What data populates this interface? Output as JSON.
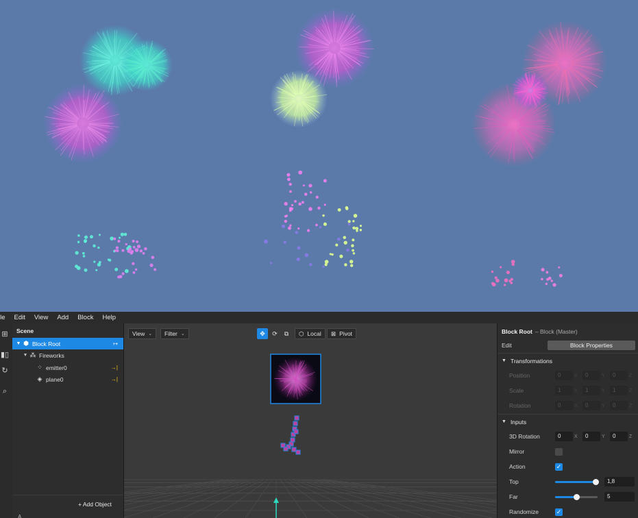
{
  "menu": [
    "ile",
    "Edit",
    "View",
    "Add",
    "Block",
    "Help"
  ],
  "scene": {
    "header": "Scene",
    "items": [
      {
        "label": "Block Root",
        "icon": "cube-icon",
        "trail": "↦"
      },
      {
        "label": "Fireworks",
        "icon": "fireworks-group-icon"
      },
      {
        "label": "emitter0",
        "icon": "emitter-icon",
        "trail": "→|"
      },
      {
        "label": "plane0",
        "icon": "plane-icon",
        "trail": "→|"
      }
    ],
    "add_object": "+ Add Object",
    "footer": "A"
  },
  "viewport": {
    "view_label": "View",
    "filter_label": "Filter",
    "local_label": "Local",
    "pivot_label": "Pivot"
  },
  "props": {
    "title": "Block Root",
    "subtitle": "– Block (Master)",
    "edit_label": "Edit",
    "block_properties": "Block Properties",
    "transformations": "Transformations",
    "position": "Position",
    "scale": "Scale",
    "rotation": "Rotation",
    "pos_values": [
      "0",
      "0",
      "0"
    ],
    "scale_values": [
      "1",
      "1",
      "1"
    ],
    "rot_values": [
      "0",
      "0",
      "0"
    ],
    "axes": [
      "X",
      "Y",
      "Z"
    ],
    "inputs": "Inputs",
    "rotation3d": "3D Rotation",
    "rotation3d_values": [
      "0",
      "0",
      "0"
    ],
    "mirror": "Mirror",
    "mirror_checked": false,
    "action": "Action",
    "action_checked": true,
    "top": "Top",
    "top_value": "1,8",
    "top_fraction": 0.95,
    "far": "Far",
    "far_value": "5",
    "far_fraction": 0.5,
    "randomize": "Randomize",
    "randomize_checked": true
  },
  "colors": {
    "accent": "#1e88e5",
    "sky": "#5b7aaa",
    "panel": "#2d2d2d"
  }
}
